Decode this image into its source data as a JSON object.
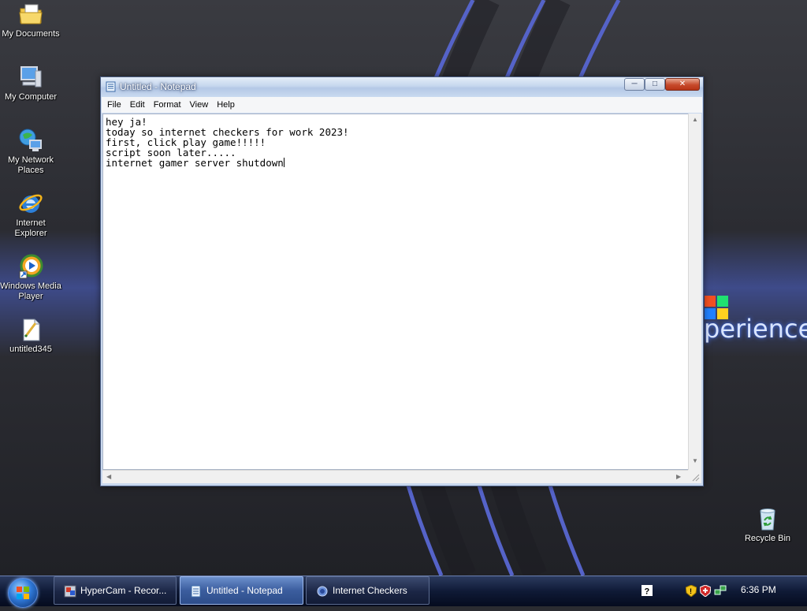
{
  "desktop": {
    "wallpaper_text": "perience",
    "icons": [
      {
        "label": "My Documents",
        "icon": "folder-icon"
      },
      {
        "label": "My Computer",
        "icon": "computer-icon"
      },
      {
        "label": "My Network Places",
        "icon": "network-icon"
      },
      {
        "label": "Internet Explorer",
        "icon": "ie-icon"
      },
      {
        "label": "Windows Media Player",
        "icon": "media-player-icon"
      },
      {
        "label": "untitled345",
        "icon": "notepad-file-icon"
      },
      {
        "label": "Recycle Bin",
        "icon": "recycle-bin-icon"
      }
    ]
  },
  "notepad": {
    "title": "Untitled - Notepad",
    "menu": [
      "File",
      "Edit",
      "Format",
      "View",
      "Help"
    ],
    "lines": [
      "hey ja!",
      "today so internet checkers for work 2023!",
      "first, click play game!!!!!",
      "script soon later.....",
      "internet gamer server shutdown"
    ]
  },
  "taskbar": {
    "buttons": [
      {
        "label": "HyperCam - Recor...",
        "icon": "hypercam-icon",
        "active": false
      },
      {
        "label": "Untitled - Notepad",
        "icon": "notepad-icon",
        "active": true
      },
      {
        "label": "Internet Checkers",
        "icon": "checkers-icon",
        "active": false
      }
    ],
    "tray": {
      "clock": "6:36 PM",
      "icons": [
        "help-icon",
        "security-shield-icon",
        "antivirus-icon",
        "network-status-icon"
      ]
    }
  },
  "colors": {
    "taskbar": "#0f1a36",
    "window_frame": "#c9d8ee",
    "accent_blue": "#3b5d9e"
  }
}
